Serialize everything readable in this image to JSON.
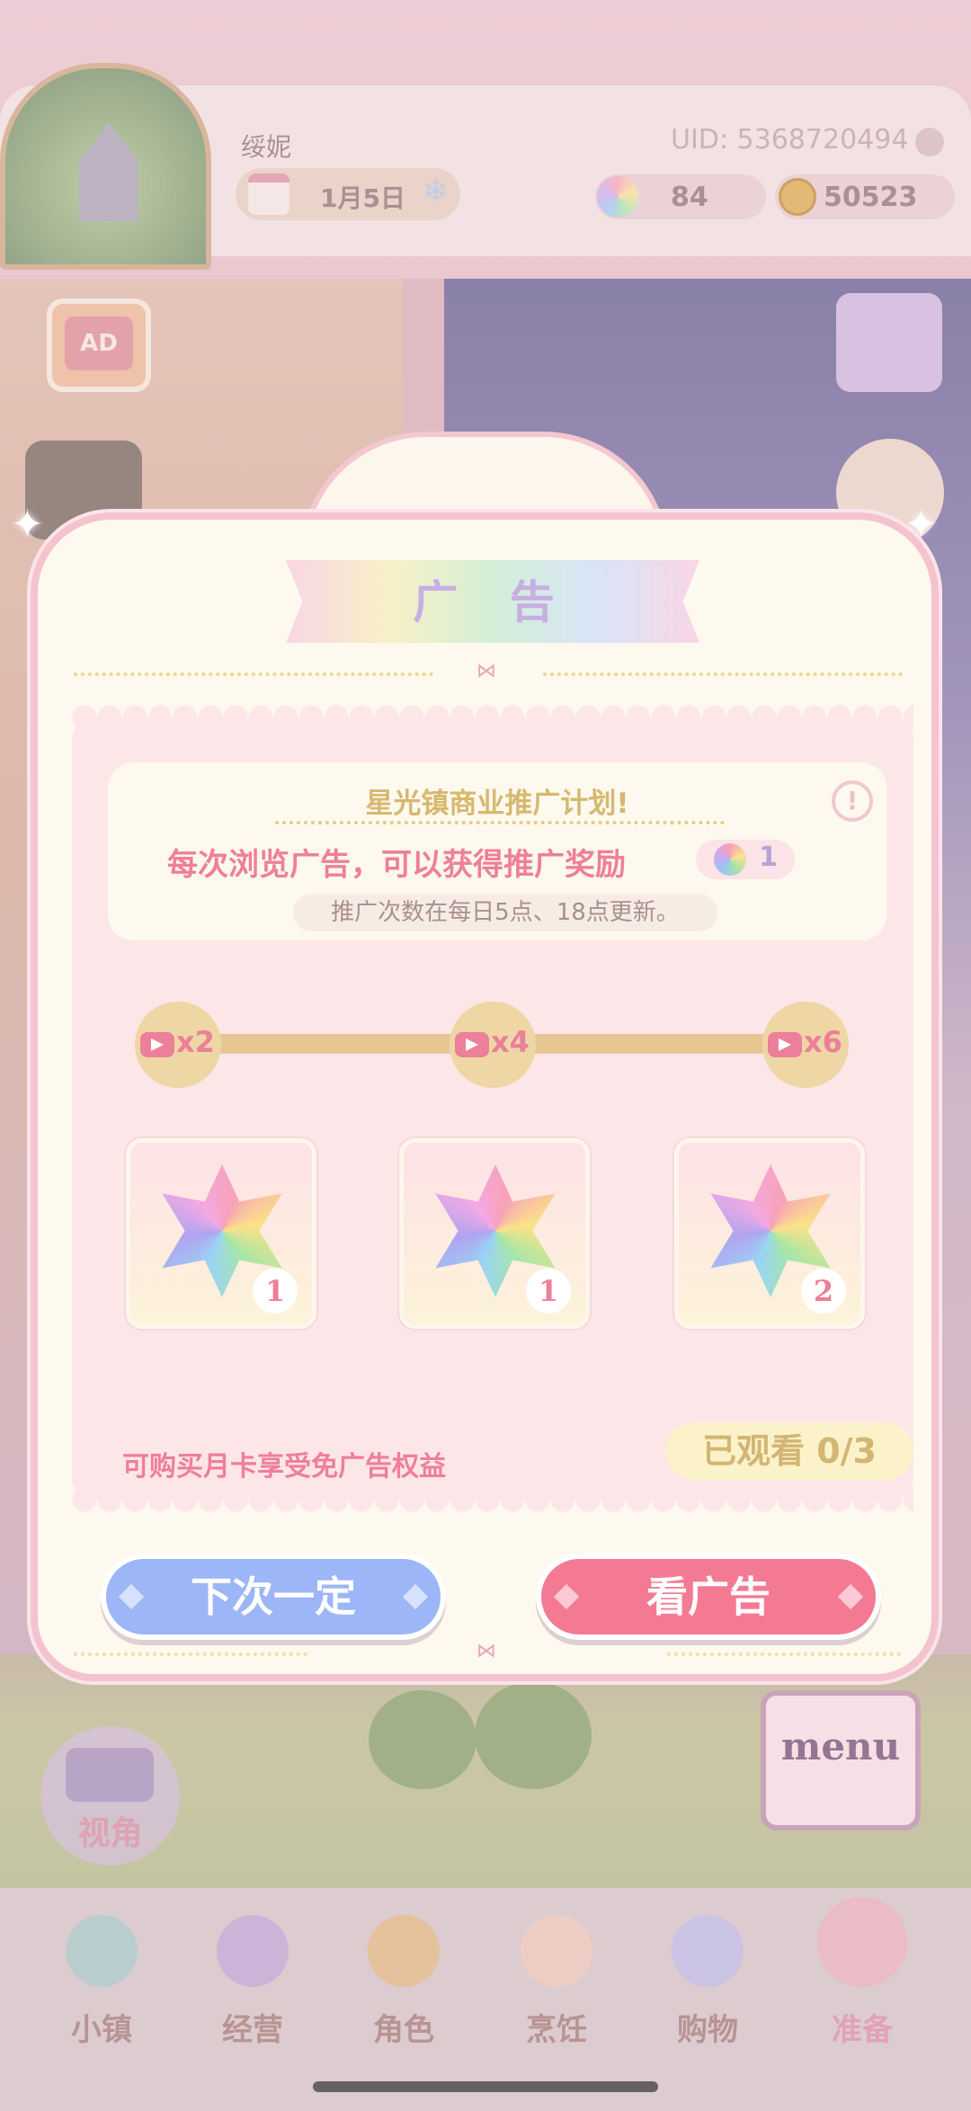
{
  "header": {
    "player_name": "绥妮",
    "uid_label": "UID: 5368720494",
    "date": "1月5日",
    "gems": "84",
    "coins": "50523"
  },
  "scene": {
    "ad_badge_label": "AD",
    "camera_label": "视角",
    "menu_label": "menu"
  },
  "modal": {
    "title": "广 告",
    "info_title": "星光镇商业推广计划!",
    "info_main": "每次浏览广告，可以获得推广奖励",
    "reward_per_ad": "1",
    "info_sub": "推广次数在每日5点、18点更新。",
    "milestones": [
      {
        "label": "x2"
      },
      {
        "label": "x4"
      },
      {
        "label": "x6"
      }
    ],
    "rewards": [
      {
        "count": "1"
      },
      {
        "count": "1"
      },
      {
        "count": "2"
      }
    ],
    "monthly_note": "可购买月卡享受免广告权益",
    "watched": "已观看 0/3",
    "watched_progress": 0,
    "later_button": "下次一定",
    "watch_button": "看广告"
  },
  "nav": {
    "items": [
      {
        "label": "小镇",
        "icon": "map-icon"
      },
      {
        "label": "经营",
        "icon": "hat-icon"
      },
      {
        "label": "角色",
        "icon": "character-icon"
      },
      {
        "label": "烹饪",
        "icon": "sandwich-icon"
      },
      {
        "label": "购物",
        "icon": "shopping-bag-icon"
      },
      {
        "label": "准备",
        "icon": "basket-icon"
      }
    ],
    "active_index": 5
  },
  "colors": {
    "accent_pink": "#f47a94",
    "accent_blue": "#9cb6f7",
    "gold": "#d3b574"
  }
}
